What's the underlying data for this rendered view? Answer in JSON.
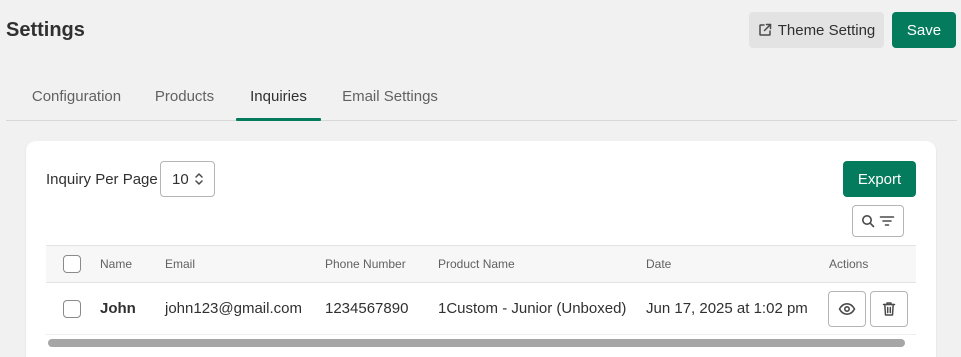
{
  "header": {
    "title": "Settings",
    "theme_setting_label": "Theme Setting",
    "save_label": "Save"
  },
  "tabs": [
    {
      "label": "Configuration",
      "active": false
    },
    {
      "label": "Products",
      "active": false
    },
    {
      "label": "Inquiries",
      "active": true
    },
    {
      "label": "Email Settings",
      "active": false
    }
  ],
  "toolbar": {
    "per_page_label": "Inquiry Per Page",
    "per_page_value": "10",
    "export_label": "Export"
  },
  "table": {
    "columns": [
      "Name",
      "Email",
      "Phone Number",
      "Product Name",
      "Date",
      "Actions"
    ],
    "rows": [
      {
        "name": "John",
        "email": "john123@gmail.com",
        "phone": "1234567890",
        "product": "1Custom - Junior (Unboxed)",
        "date": "Jun 17, 2025 at 1:02 pm"
      }
    ]
  },
  "colors": {
    "primary": "#047b5d",
    "background": "#f1f1f1",
    "secondary_button": "#e3e3e3"
  },
  "icons": [
    "external-link-icon",
    "chevron-up-down-icon",
    "search-icon",
    "filter-icon",
    "eye-icon",
    "trash-icon"
  ]
}
